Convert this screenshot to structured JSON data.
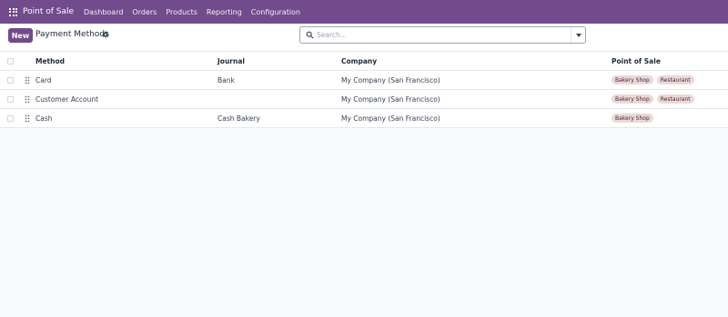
{
  "navbar": {
    "app_name": "Point of Sale",
    "menu": [
      "Dashboard",
      "Orders",
      "Products",
      "Reporting",
      "Configuration"
    ]
  },
  "control": {
    "new_label": "New",
    "title": "Payment Methods",
    "search_placeholder": "Search..."
  },
  "table": {
    "headers": {
      "method": "Method",
      "journal": "Journal",
      "company": "Company",
      "pos": "Point of Sale"
    },
    "rows": [
      {
        "method": "Card",
        "journal": "Bank",
        "company": "My Company (San Francisco)",
        "pos": [
          "Bakery Shop",
          "Restaurant"
        ]
      },
      {
        "method": "Customer Account",
        "journal": "",
        "company": "My Company (San Francisco)",
        "pos": [
          "Bakery Shop",
          "Restaurant"
        ]
      },
      {
        "method": "Cash",
        "journal": "Cash Bakery",
        "company": "My Company (San Francisco)",
        "pos": [
          "Bakery Shop"
        ]
      }
    ]
  },
  "colors": {
    "brand": "#714b8c",
    "tag_bg": "#ead9da"
  }
}
